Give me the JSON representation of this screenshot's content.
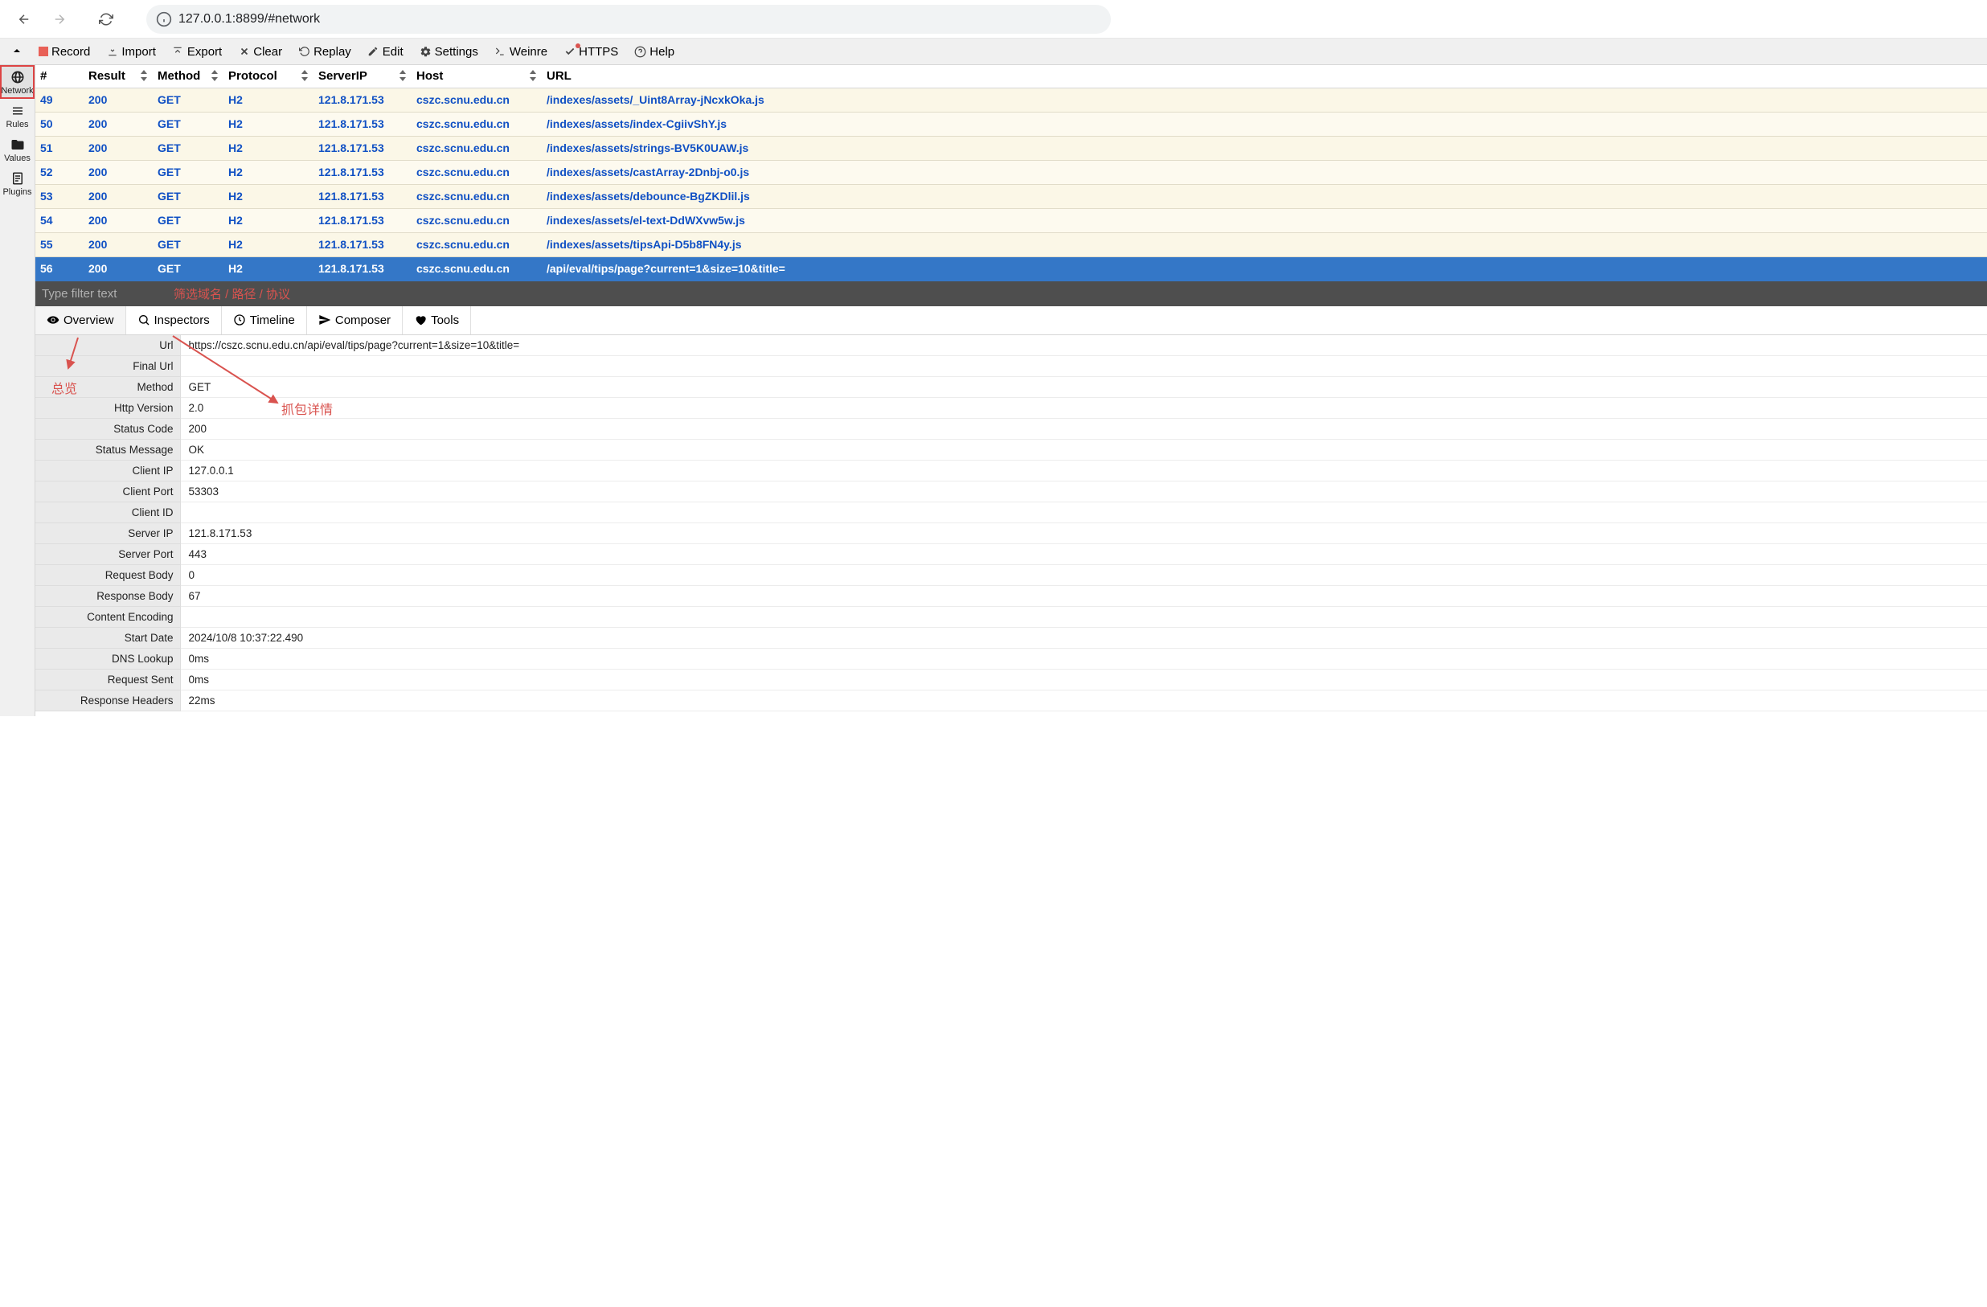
{
  "browser": {
    "url": "127.0.0.1:8899/#network"
  },
  "toolbar": {
    "record": "Record",
    "import": "Import",
    "export": "Export",
    "clear": "Clear",
    "replay": "Replay",
    "edit": "Edit",
    "settings": "Settings",
    "weinre": "Weinre",
    "https": "HTTPS",
    "help": "Help"
  },
  "sidebar": {
    "items": [
      {
        "label": "Network"
      },
      {
        "label": "Rules"
      },
      {
        "label": "Values"
      },
      {
        "label": "Plugins"
      }
    ]
  },
  "network_header": {
    "num": "#",
    "result": "Result",
    "method": "Method",
    "protocol": "Protocol",
    "serverip": "ServerIP",
    "host": "Host",
    "url": "URL"
  },
  "network_rows": [
    {
      "num": "49",
      "result": "200",
      "method": "GET",
      "protocol": "H2",
      "serverip": "121.8.171.53",
      "host": "cszc.scnu.edu.cn",
      "url": "/indexes/assets/_Uint8Array-jNcxkOka.js"
    },
    {
      "num": "50",
      "result": "200",
      "method": "GET",
      "protocol": "H2",
      "serverip": "121.8.171.53",
      "host": "cszc.scnu.edu.cn",
      "url": "/indexes/assets/index-CgiivShY.js"
    },
    {
      "num": "51",
      "result": "200",
      "method": "GET",
      "protocol": "H2",
      "serverip": "121.8.171.53",
      "host": "cszc.scnu.edu.cn",
      "url": "/indexes/assets/strings-BV5K0UAW.js"
    },
    {
      "num": "52",
      "result": "200",
      "method": "GET",
      "protocol": "H2",
      "serverip": "121.8.171.53",
      "host": "cszc.scnu.edu.cn",
      "url": "/indexes/assets/castArray-2Dnbj-o0.js"
    },
    {
      "num": "53",
      "result": "200",
      "method": "GET",
      "protocol": "H2",
      "serverip": "121.8.171.53",
      "host": "cszc.scnu.edu.cn",
      "url": "/indexes/assets/debounce-BgZKDlil.js"
    },
    {
      "num": "54",
      "result": "200",
      "method": "GET",
      "protocol": "H2",
      "serverip": "121.8.171.53",
      "host": "cszc.scnu.edu.cn",
      "url": "/indexes/assets/el-text-DdWXvw5w.js"
    },
    {
      "num": "55",
      "result": "200",
      "method": "GET",
      "protocol": "H2",
      "serverip": "121.8.171.53",
      "host": "cszc.scnu.edu.cn",
      "url": "/indexes/assets/tipsApi-D5b8FN4y.js"
    },
    {
      "num": "56",
      "result": "200",
      "method": "GET",
      "protocol": "H2",
      "serverip": "121.8.171.53",
      "host": "cszc.scnu.edu.cn",
      "url": "/api/eval/tips/page?current=1&size=10&title=",
      "selected": true
    }
  ],
  "filter": {
    "placeholder": "Type filter text",
    "hint": "筛选域名 / 路径 / 协议"
  },
  "detail_tabs": {
    "overview": "Overview",
    "inspectors": "Inspectors",
    "timeline": "Timeline",
    "composer": "Composer",
    "tools": "Tools"
  },
  "overview": [
    {
      "label": "Url",
      "value": "https://cszc.scnu.edu.cn/api/eval/tips/page?current=1&size=10&title="
    },
    {
      "label": "Final Url",
      "value": ""
    },
    {
      "label": "Method",
      "value": "GET"
    },
    {
      "label": "Http Version",
      "value": "2.0"
    },
    {
      "label": "Status Code",
      "value": "200"
    },
    {
      "label": "Status Message",
      "value": "OK"
    },
    {
      "label": "Client IP",
      "value": "127.0.0.1"
    },
    {
      "label": "Client Port",
      "value": "53303"
    },
    {
      "label": "Client ID",
      "value": ""
    },
    {
      "label": "Server IP",
      "value": "121.8.171.53"
    },
    {
      "label": "Server Port",
      "value": "443"
    },
    {
      "label": "Request Body",
      "value": "0"
    },
    {
      "label": "Response Body",
      "value": "67"
    },
    {
      "label": "Content Encoding",
      "value": ""
    },
    {
      "label": "Start Date",
      "value": "2024/10/8 10:37:22.490"
    },
    {
      "label": "DNS Lookup",
      "value": "0ms"
    },
    {
      "label": "Request Sent",
      "value": "0ms"
    },
    {
      "label": "Response Headers",
      "value": "22ms"
    }
  ],
  "annotations": {
    "overview_label": "总览",
    "detail_label": "抓包详情"
  }
}
